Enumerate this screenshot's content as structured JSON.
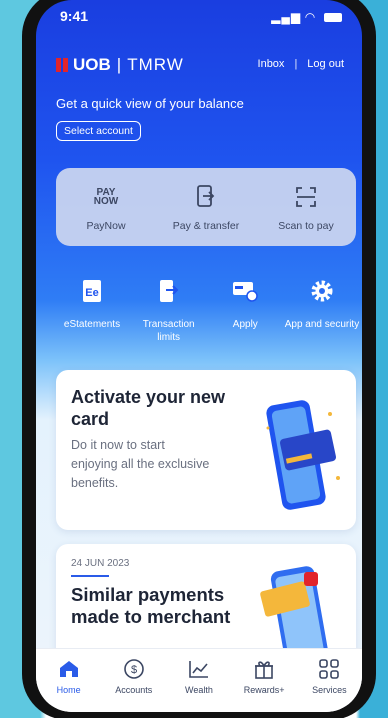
{
  "status_bar": {
    "time": "9:41"
  },
  "header": {
    "logo_uob": "UOB",
    "logo_tmrw": "TMRW",
    "inbox": "Inbox",
    "logout": "Log out"
  },
  "balance": {
    "title": "Get a quick view of your balance",
    "select_account": "Select account"
  },
  "pay_actions": [
    {
      "label": "PayNow",
      "icon": "paynow-logo"
    },
    {
      "label": "Pay & transfer",
      "icon": "pay-transfer-icon"
    },
    {
      "label": "Scan to pay",
      "icon": "scan-icon"
    }
  ],
  "paynow_logo": {
    "line1": "PAY",
    "line2": "NOW"
  },
  "shortcuts": [
    {
      "label": "eStatements",
      "icon": "estatement-icon"
    },
    {
      "label": "Transaction limits",
      "icon": "transaction-limits-icon"
    },
    {
      "label": "Apply",
      "icon": "apply-icon"
    },
    {
      "label": "App and security",
      "icon": "gear-icon"
    }
  ],
  "cards": {
    "activate": {
      "title": "Activate your new card",
      "description": "Do it now to start enjoying all the exclusive benefits."
    },
    "payments": {
      "date": "24 JUN 2023",
      "title": "Similar payments made to merchant"
    }
  },
  "tab_bar": [
    {
      "label": "Home",
      "icon": "home-icon",
      "active": true
    },
    {
      "label": "Accounts",
      "icon": "dollar-circle-icon",
      "active": false
    },
    {
      "label": "Wealth",
      "icon": "chart-icon",
      "active": false
    },
    {
      "label": "Rewards+",
      "icon": "gift-icon",
      "active": false
    },
    {
      "label": "Services",
      "icon": "grid-icon",
      "active": false
    }
  ],
  "colors": {
    "brand_blue": "#1f54ef",
    "brand_red": "#e1242b",
    "active_tab": "#2a5be8"
  }
}
